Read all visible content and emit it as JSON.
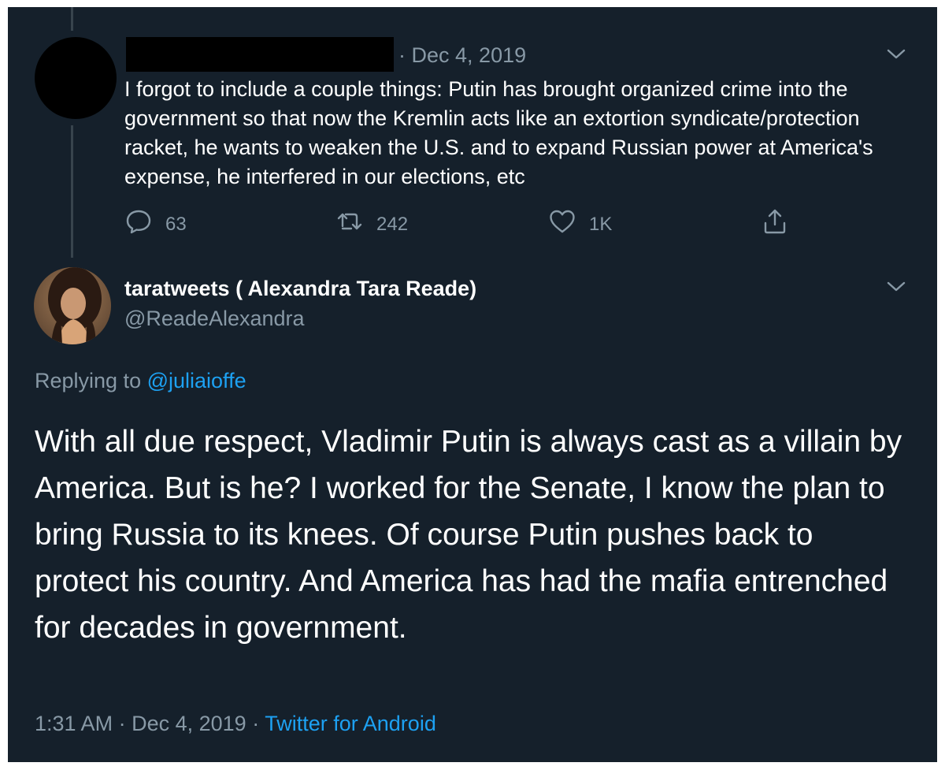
{
  "parent_tweet": {
    "date": "Dec 4, 2019",
    "text": "I forgot to include a couple things: Putin has brought organized crime into the government so that now the Kremlin acts like an extortion syndicate/protection racket, he wants to weaken the U.S. and to expand Russian power at America's expense, he interfered in our elections, etc",
    "replies": "63",
    "retweets": "242",
    "likes": "1K"
  },
  "main_tweet": {
    "display_name": "taratweets ( Alexandra Tara Reade)",
    "handle": "@ReadeAlexandra",
    "replying_prefix": "Replying to",
    "replying_to": "@juliaioffe",
    "text": "With all due respect, Vladimir Putin is always cast as a villain by America. But is he? I worked for the Senate, I know the plan to bring Russia to its knees. Of course Putin pushes back to protect his country. And America has had the mafia entrenched for decades in government.",
    "time": "1:31 AM",
    "date": "Dec 4, 2019",
    "source": "Twitter for Android"
  },
  "separator": "·",
  "icons": {
    "reply": "reply-icon",
    "retweet": "retweet-icon",
    "like": "heart-icon",
    "share": "share-icon",
    "menu": "chevron-down-icon"
  },
  "colors": {
    "background": "#15202b",
    "text": "#ffffff",
    "muted": "#8899a6",
    "link": "#1da1f2",
    "thread_line": "#38444d"
  }
}
